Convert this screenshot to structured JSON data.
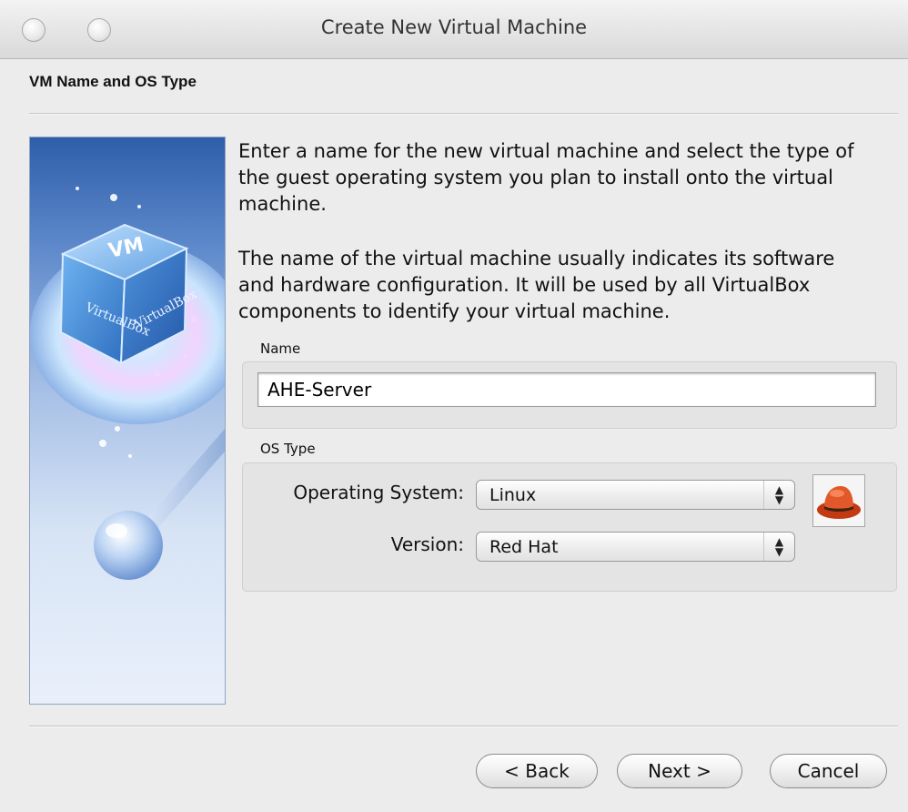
{
  "window": {
    "title": "Create New Virtual Machine"
  },
  "header": {
    "section_title": "VM Name and OS Type"
  },
  "description": {
    "paragraph1": "Enter a name for the new virtual machine and select the type of the guest operating system you plan to install onto the virtual machine.",
    "paragraph2": "The name of the virtual machine usually indicates its software and hardware configuration. It will be used by all VirtualBox components to identify your virtual machine."
  },
  "name_group": {
    "label": "Name",
    "value": "AHE-Server"
  },
  "os_group": {
    "label": "OS Type",
    "os_label": "Operating System:",
    "os_value": "Linux",
    "version_label": "Version:",
    "version_value": "Red Hat",
    "icon": "red-hat-fedora-icon"
  },
  "buttons": {
    "back": "< Back",
    "next": "Next >",
    "cancel": "Cancel"
  },
  "sidebar_image": {
    "logo_text_left": "VirtualBox",
    "logo_text_right": "VirtualBox"
  }
}
